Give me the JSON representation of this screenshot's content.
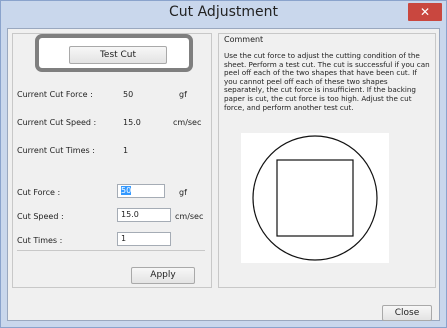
{
  "window": {
    "title": "Cut Adjustment",
    "close_glyph": "✕"
  },
  "left": {
    "test_cut_label": "Test Cut",
    "current": [
      {
        "label": "Current Cut Force :",
        "value": "50",
        "unit": "gf"
      },
      {
        "label": "Current Cut Speed :",
        "value": "15.0",
        "unit": "cm/sec"
      },
      {
        "label": "Current Cut Times :",
        "value": "1",
        "unit": ""
      }
    ],
    "settings": [
      {
        "label": "Cut Force :",
        "value": "50",
        "unit": "gf",
        "selected": true
      },
      {
        "label": "Cut Speed :",
        "value": "15.0",
        "unit": "cm/sec",
        "selected": false
      },
      {
        "label": "Cut Times :",
        "value": "1",
        "unit": "",
        "selected": false
      }
    ],
    "apply_label": "Apply"
  },
  "right": {
    "comment_title": "Comment",
    "comment_text": "Use the cut force to adjust the cutting condition of the sheet. Perform a test cut. The cut is successful if you can peel off each of the two shapes that have been cut. If you cannot peel off each of these two shapes separately, the cut force is insufficient. If the backing paper is cut, the cut force is too high. Adjust the cut force, and perform another test cut."
  },
  "footer": {
    "close_label": "Close"
  },
  "colors": {
    "titlebar": "#c9d7ec",
    "close": "#c9473f",
    "selection": "#3399ff",
    "highlight_border": "#7f7f7f"
  }
}
